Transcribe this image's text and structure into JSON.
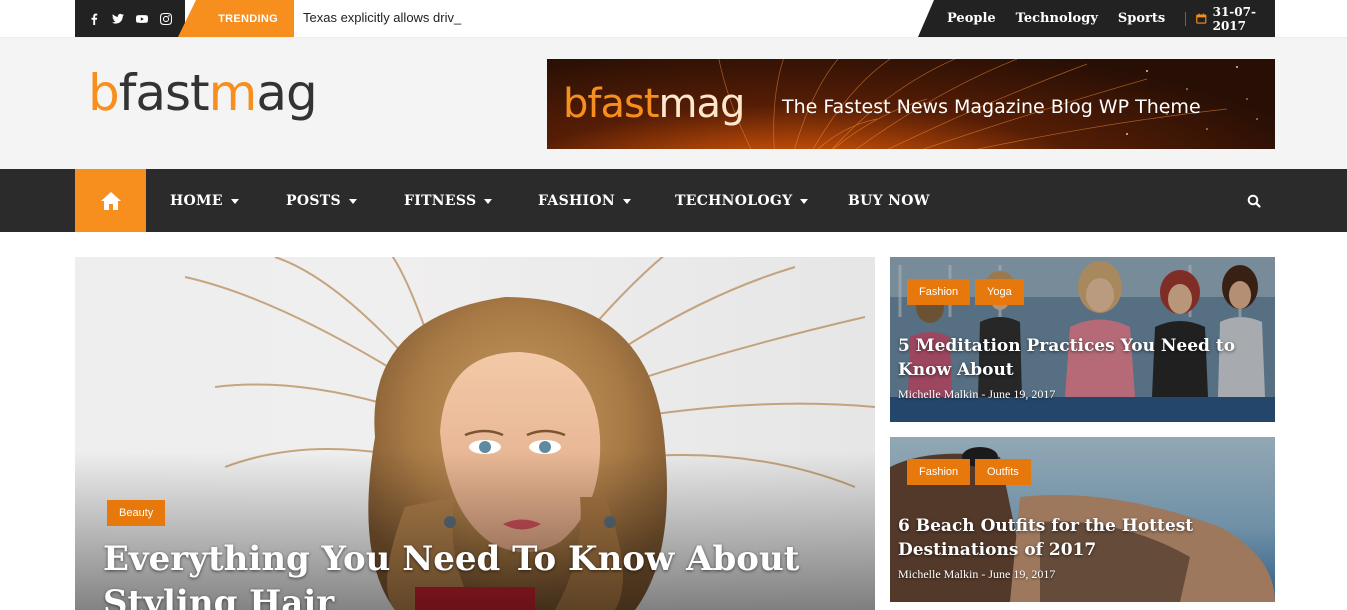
{
  "topbar": {
    "social": [
      "facebook-icon",
      "twitter-icon",
      "youtube-icon",
      "instagram-icon"
    ],
    "trending_label": "TRENDING",
    "ticker_text": "Texas explicitly allows driv_",
    "links": [
      "People",
      "Technology",
      "Sports"
    ],
    "date": "31-07-2017"
  },
  "header": {
    "logo_orange": "b",
    "logo_dark_1": "fast",
    "logo_orange_2": "m",
    "logo_dark_2": "ag",
    "banner_logo_a": "bfast",
    "banner_logo_b": "mag",
    "banner_tagline": "The Fastest News Magazine Blog WP Theme"
  },
  "nav": {
    "items": [
      "HOME",
      "POSTS",
      "FITNESS",
      "FASHION",
      "TECHNOLOGY",
      "BUY NOW"
    ],
    "dropdown": [
      true,
      true,
      true,
      true,
      true,
      false
    ]
  },
  "featured": {
    "category": "Beauty",
    "title": "Everything You Need To Know About Styling Hair"
  },
  "side_posts": [
    {
      "categories": [
        "Fashion",
        "Yoga"
      ],
      "title_line1": "5 Meditation Practices You Need to",
      "title_line2": "Know About",
      "author": "Michelle Malkin",
      "date": "June 19, 2017"
    },
    {
      "categories": [
        "Fashion",
        "Outfits"
      ],
      "title_line1": "6 Beach Outfits for the Hottest",
      "title_line2": "Destinations of 2017",
      "author": "Michelle Malkin",
      "date": "June 19, 2017"
    }
  ],
  "colors": {
    "accent": "#f78f1e",
    "dark": "#2b2b2b",
    "category_bg": "#e7780b"
  }
}
